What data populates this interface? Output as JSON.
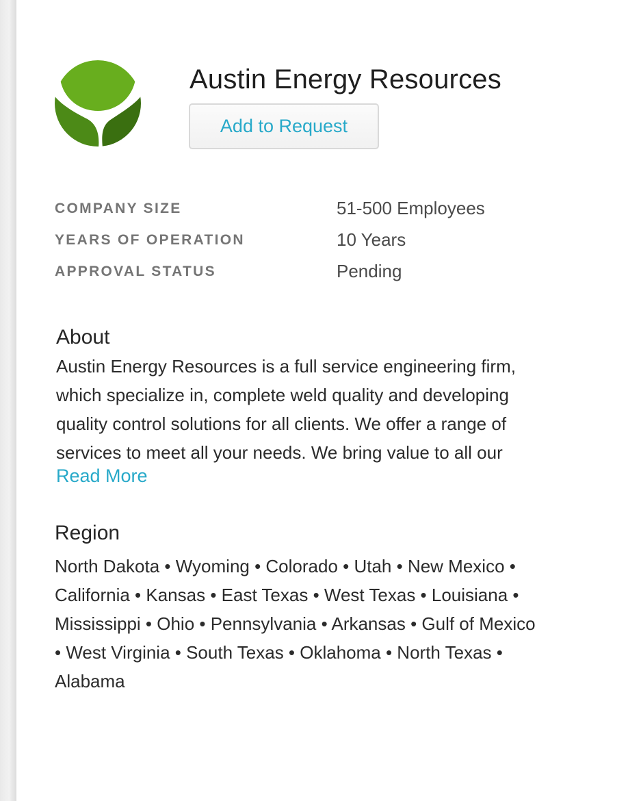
{
  "company": {
    "name": "Austin Energy Resources",
    "logo_icon": "sprout-leaf-logo",
    "logo_colors": [
      "#65ad1c",
      "#3f7a12",
      "#2e5e0b"
    ]
  },
  "actions": {
    "add_to_request_label": "Add to Request"
  },
  "facts": [
    {
      "label": "COMPANY SIZE",
      "value": "51-500 Employees"
    },
    {
      "label": "YEARS OF OPERATION",
      "value": "10 Years"
    },
    {
      "label": "APPROVAL STATUS",
      "value": "Pending"
    }
  ],
  "about": {
    "title": "About",
    "lines": [
      "Austin Energy Resources is a full service engineering firm,",
      "which specialize in, complete weld quality and developing",
      "quality control solutions for all clients. We offer a range of",
      "services to meet all your needs. We bring value to all our"
    ],
    "read_more_label": "Read More"
  },
  "region": {
    "title": "Region",
    "lines": [
      "North Dakota • Wyoming • Colorado • Utah • New Mexico •",
      "California • Kansas • East Texas • West Texas • Louisiana •",
      "Mississippi • Ohio • Pennsylvania • Arkansas • Gulf of Mexico",
      "• West Virginia • South Texas • Oklahoma • North Texas •",
      "Alabama"
    ]
  },
  "colors": {
    "accent": "#27a9c9",
    "label_gray": "#757575"
  }
}
